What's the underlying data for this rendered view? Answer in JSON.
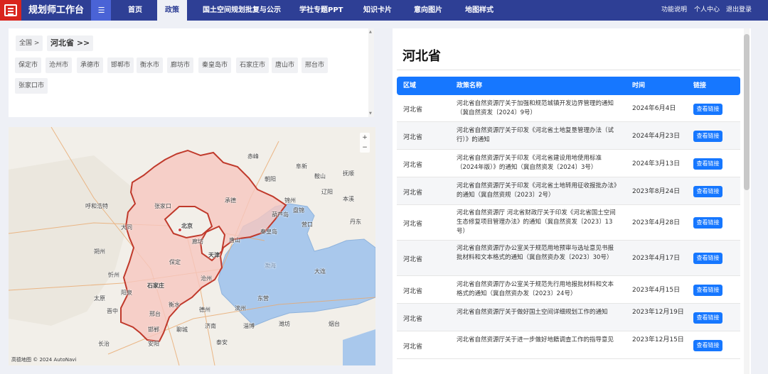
{
  "app": {
    "brand": "规划师工作台",
    "menu_toggle": "☰"
  },
  "nav": {
    "tabs": [
      {
        "label": "首页"
      },
      {
        "label": "政策"
      },
      {
        "label": "国土空间规划批复与公示"
      },
      {
        "label": "学社专题PPT"
      },
      {
        "label": "知识卡片"
      },
      {
        "label": "意向图片"
      },
      {
        "label": "地图样式"
      }
    ],
    "active": "政策",
    "utilities": [
      {
        "label": "功能说明"
      },
      {
        "label": "个人中心"
      },
      {
        "label": "退出登录"
      }
    ]
  },
  "filter": {
    "breadcrumb_all": "全国 >",
    "breadcrumb_current": "河北省 >>",
    "cities": [
      "保定市",
      "沧州市",
      "承德市",
      "邯郸市",
      "衡水市",
      "廊坊市",
      "秦皇岛市",
      "石家庄市",
      "唐山市",
      "邢台市",
      "张家口市"
    ]
  },
  "map": {
    "labels": [
      {
        "text": "呼和浩特",
        "type": "city"
      },
      {
        "text": "张家口",
        "type": "city"
      },
      {
        "text": "北京",
        "type": "city"
      },
      {
        "text": "承德",
        "type": "city"
      },
      {
        "text": "唐山",
        "type": "city"
      },
      {
        "text": "秦皇岛",
        "type": "city"
      },
      {
        "text": "廊坊",
        "type": "city"
      },
      {
        "text": "天津",
        "type": "city"
      },
      {
        "text": "保定",
        "type": "city"
      },
      {
        "text": "沧州",
        "type": "city"
      },
      {
        "text": "石家庄",
        "type": "city"
      },
      {
        "text": "衡水",
        "type": "city"
      },
      {
        "text": "邢台",
        "type": "city"
      },
      {
        "text": "邯郸",
        "type": "city"
      },
      {
        "text": "大同",
        "type": "city"
      },
      {
        "text": "朔州",
        "type": "city"
      },
      {
        "text": "忻州",
        "type": "city"
      },
      {
        "text": "太原",
        "type": "city"
      },
      {
        "text": "阳泉",
        "type": "city"
      },
      {
        "text": "晋中",
        "type": "city"
      },
      {
        "text": "长治",
        "type": "city"
      },
      {
        "text": "安阳",
        "type": "city"
      },
      {
        "text": "济南",
        "type": "city"
      },
      {
        "text": "德州",
        "type": "city"
      },
      {
        "text": "聊城",
        "type": "city"
      },
      {
        "text": "泰安",
        "type": "city"
      },
      {
        "text": "淄博",
        "type": "city"
      },
      {
        "text": "滨州",
        "type": "city"
      },
      {
        "text": "东营",
        "type": "city"
      },
      {
        "text": "潍坊",
        "type": "city"
      },
      {
        "text": "营口",
        "type": "city"
      },
      {
        "text": "锦州",
        "type": "city"
      },
      {
        "text": "葫芦岛",
        "type": "city"
      },
      {
        "text": "大连",
        "type": "city"
      },
      {
        "text": "鞍山",
        "type": "city"
      },
      {
        "text": "辽阳",
        "type": "city"
      },
      {
        "text": "抚顺",
        "type": "city"
      },
      {
        "text": "阜新",
        "type": "city"
      },
      {
        "text": "朝阳",
        "type": "city"
      },
      {
        "text": "赤峰",
        "type": "city"
      },
      {
        "text": "丹东",
        "type": "city"
      },
      {
        "text": "本溪",
        "type": "city"
      },
      {
        "text": "盘锦",
        "type": "city"
      },
      {
        "text": "烟台",
        "type": "city"
      },
      {
        "text": "渤海",
        "type": "sea"
      }
    ],
    "attribution": "高德地图 © 2024 AutoNavi",
    "zoom_in": "+",
    "zoom_out": "−",
    "colors": {
      "highlight_fill": "#f6c7bf",
      "highlight_border": "#c0392b",
      "sea": "#a9c8ec",
      "land": "#f2efe9"
    }
  },
  "policy": {
    "title": "河北省",
    "columns": {
      "region": "区域",
      "name": "政策名称",
      "time": "时间",
      "link": "链接"
    },
    "link_label": "查看链接",
    "rows": [
      {
        "region": "河北省",
        "name": "河北省自然资源厅关于加强和规范城镇开发边界管理的通知（冀自然资发〔2024〕9号）",
        "time": "2024年6月4日"
      },
      {
        "region": "河北省",
        "name": "河北省自然资源厅关于印发《河北省土地复垦管理办法（试行）》的通知",
        "time": "2024年4月23日"
      },
      {
        "region": "河北省",
        "name": "河北省自然资源厅关于印发《河北省建设用地使用标准（2024年版）》的通知（冀自然资发〔2024〕3号）",
        "time": "2024年3月13日"
      },
      {
        "region": "河北省",
        "name": "河北省自然资源厅关于印发《河北省土地转用征收报批办法》的通知（冀自然资规〔2023〕2号）",
        "time": "2023年8月24日"
      },
      {
        "region": "河北省",
        "name": "河北省自然资源厅 河北省财政厅关于印发《河北省国土空间生态修复项目管理办法》的通知（冀自然资发〔2023〕13号）",
        "time": "2023年4月28日"
      },
      {
        "region": "河北省",
        "name": "河北省自然资源厅办公室关于规范用地预审与选址意见书报批材料和文本格式的通知（冀自然资办发〔2023〕30号）",
        "time": "2023年4月17日"
      },
      {
        "region": "河北省",
        "name": "河北省自然资源厅办公室关于规范先行用地报批材料和文本格式的通知（冀自然资办发〔2023〕24号）",
        "time": "2023年4月15日"
      },
      {
        "region": "河北省",
        "name": "河北省自然资源厅关于做好国土空间详细规划工作的通知",
        "time": "2023年12月19日"
      },
      {
        "region": "河北省",
        "name": "河北省自然资源厅关于进一步做好地籍调查工作的指导意见",
        "time": "2023年12月15日"
      }
    ]
  }
}
